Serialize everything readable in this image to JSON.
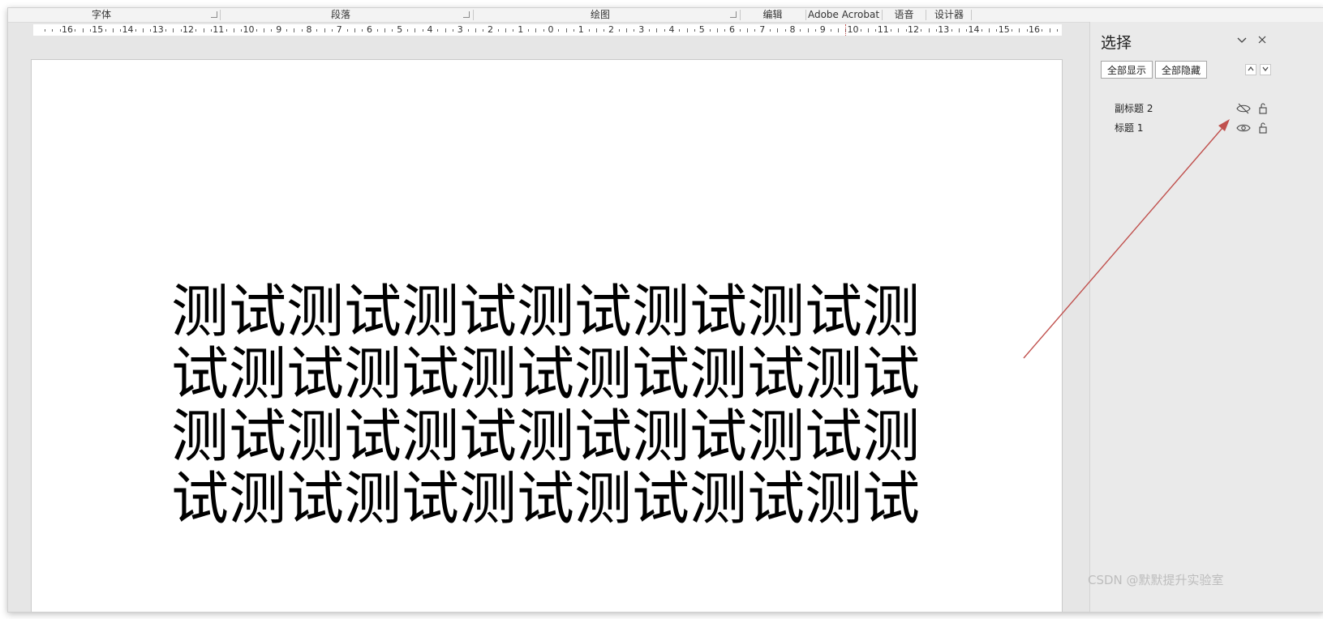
{
  "ribbon": {
    "groups": [
      {
        "label": "字体"
      },
      {
        "label": "段落"
      },
      {
        "label": "绘图"
      },
      {
        "label": "编辑"
      },
      {
        "label": "Adobe Acrobat"
      },
      {
        "label": "语音"
      },
      {
        "label": "设计器"
      }
    ]
  },
  "ruler": {
    "labels": [
      "16",
      "15",
      "14",
      "13",
      "12",
      "11",
      "10",
      "9",
      "8",
      "7",
      "6",
      "5",
      "4",
      "3",
      "2",
      "1",
      "0",
      "1",
      "2",
      "3",
      "4",
      "5",
      "6",
      "7",
      "8",
      "9",
      "10",
      "11",
      "12",
      "13",
      "14",
      "15",
      "16"
    ]
  },
  "slide": {
    "lines": [
      "测试测试测试测试测试测试测",
      "试测试测试测试测试测试测试",
      "测试测试测试测试测试测试测",
      "试测试测试测试测试测试测试"
    ]
  },
  "selection_pane": {
    "title": "选择",
    "show_all_label": "全部显示",
    "hide_all_label": "全部隐藏",
    "move_up_label": "^",
    "move_down_label": "v",
    "collapse_label": "⌵",
    "close_label": "×",
    "items": [
      {
        "label": "副标题 2",
        "visible": false
      },
      {
        "label": "标题 1",
        "visible": true
      }
    ]
  },
  "watermark": "CSDN @默默提升实验室",
  "colors": {
    "annotation_arrow": "#c0504d",
    "pane_bg": "#eaeaea",
    "workspace_bg": "#e6e6e6"
  }
}
